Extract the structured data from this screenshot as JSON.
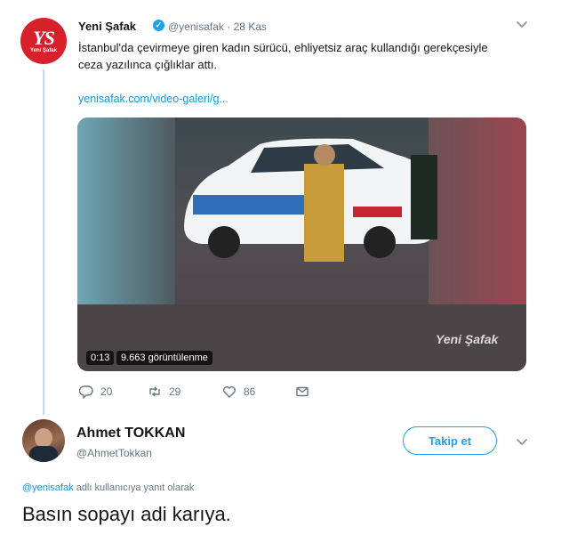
{
  "tweet1": {
    "avatar_text": "YS",
    "avatar_subtext": "Yeni Şafak",
    "name": "Yeni Şafak",
    "handle": "@yenisafak",
    "date": "· 28 Kas",
    "text_line1": "İstanbul'da çevirmeye giren kadın sürücü, ehliyetsiz araç kullandığı gerekçesiyle",
    "text_line2": "ceza yazılınca çığlıklar attı.",
    "link": "yenisafak.com/video-galeri/g...",
    "video": {
      "time": "0:13",
      "views": "9.663 görüntülenme",
      "watermark": "Yeni Şafak"
    },
    "actions": {
      "reply_count": "20",
      "retweet_count": "29",
      "like_count": "86"
    }
  },
  "tweet2": {
    "name": "Ahmet TOKKAN",
    "handle": "@AhmetTokkan",
    "follow_label": "Takip et",
    "reply_to_handle": "@yenisafak",
    "reply_to_suffix": " adlı kullanıcıya yanıt olarak",
    "text": "Basın sopayı adi karıya."
  },
  "colors": {
    "brand_blue": "#1da1f2",
    "link_blue": "#1b95e0",
    "muted": "#657786",
    "avatar_red": "#d6202a"
  },
  "icons": [
    "verified-icon",
    "chevron-down-icon",
    "reply-icon",
    "retweet-icon",
    "like-icon",
    "dm-icon"
  ]
}
